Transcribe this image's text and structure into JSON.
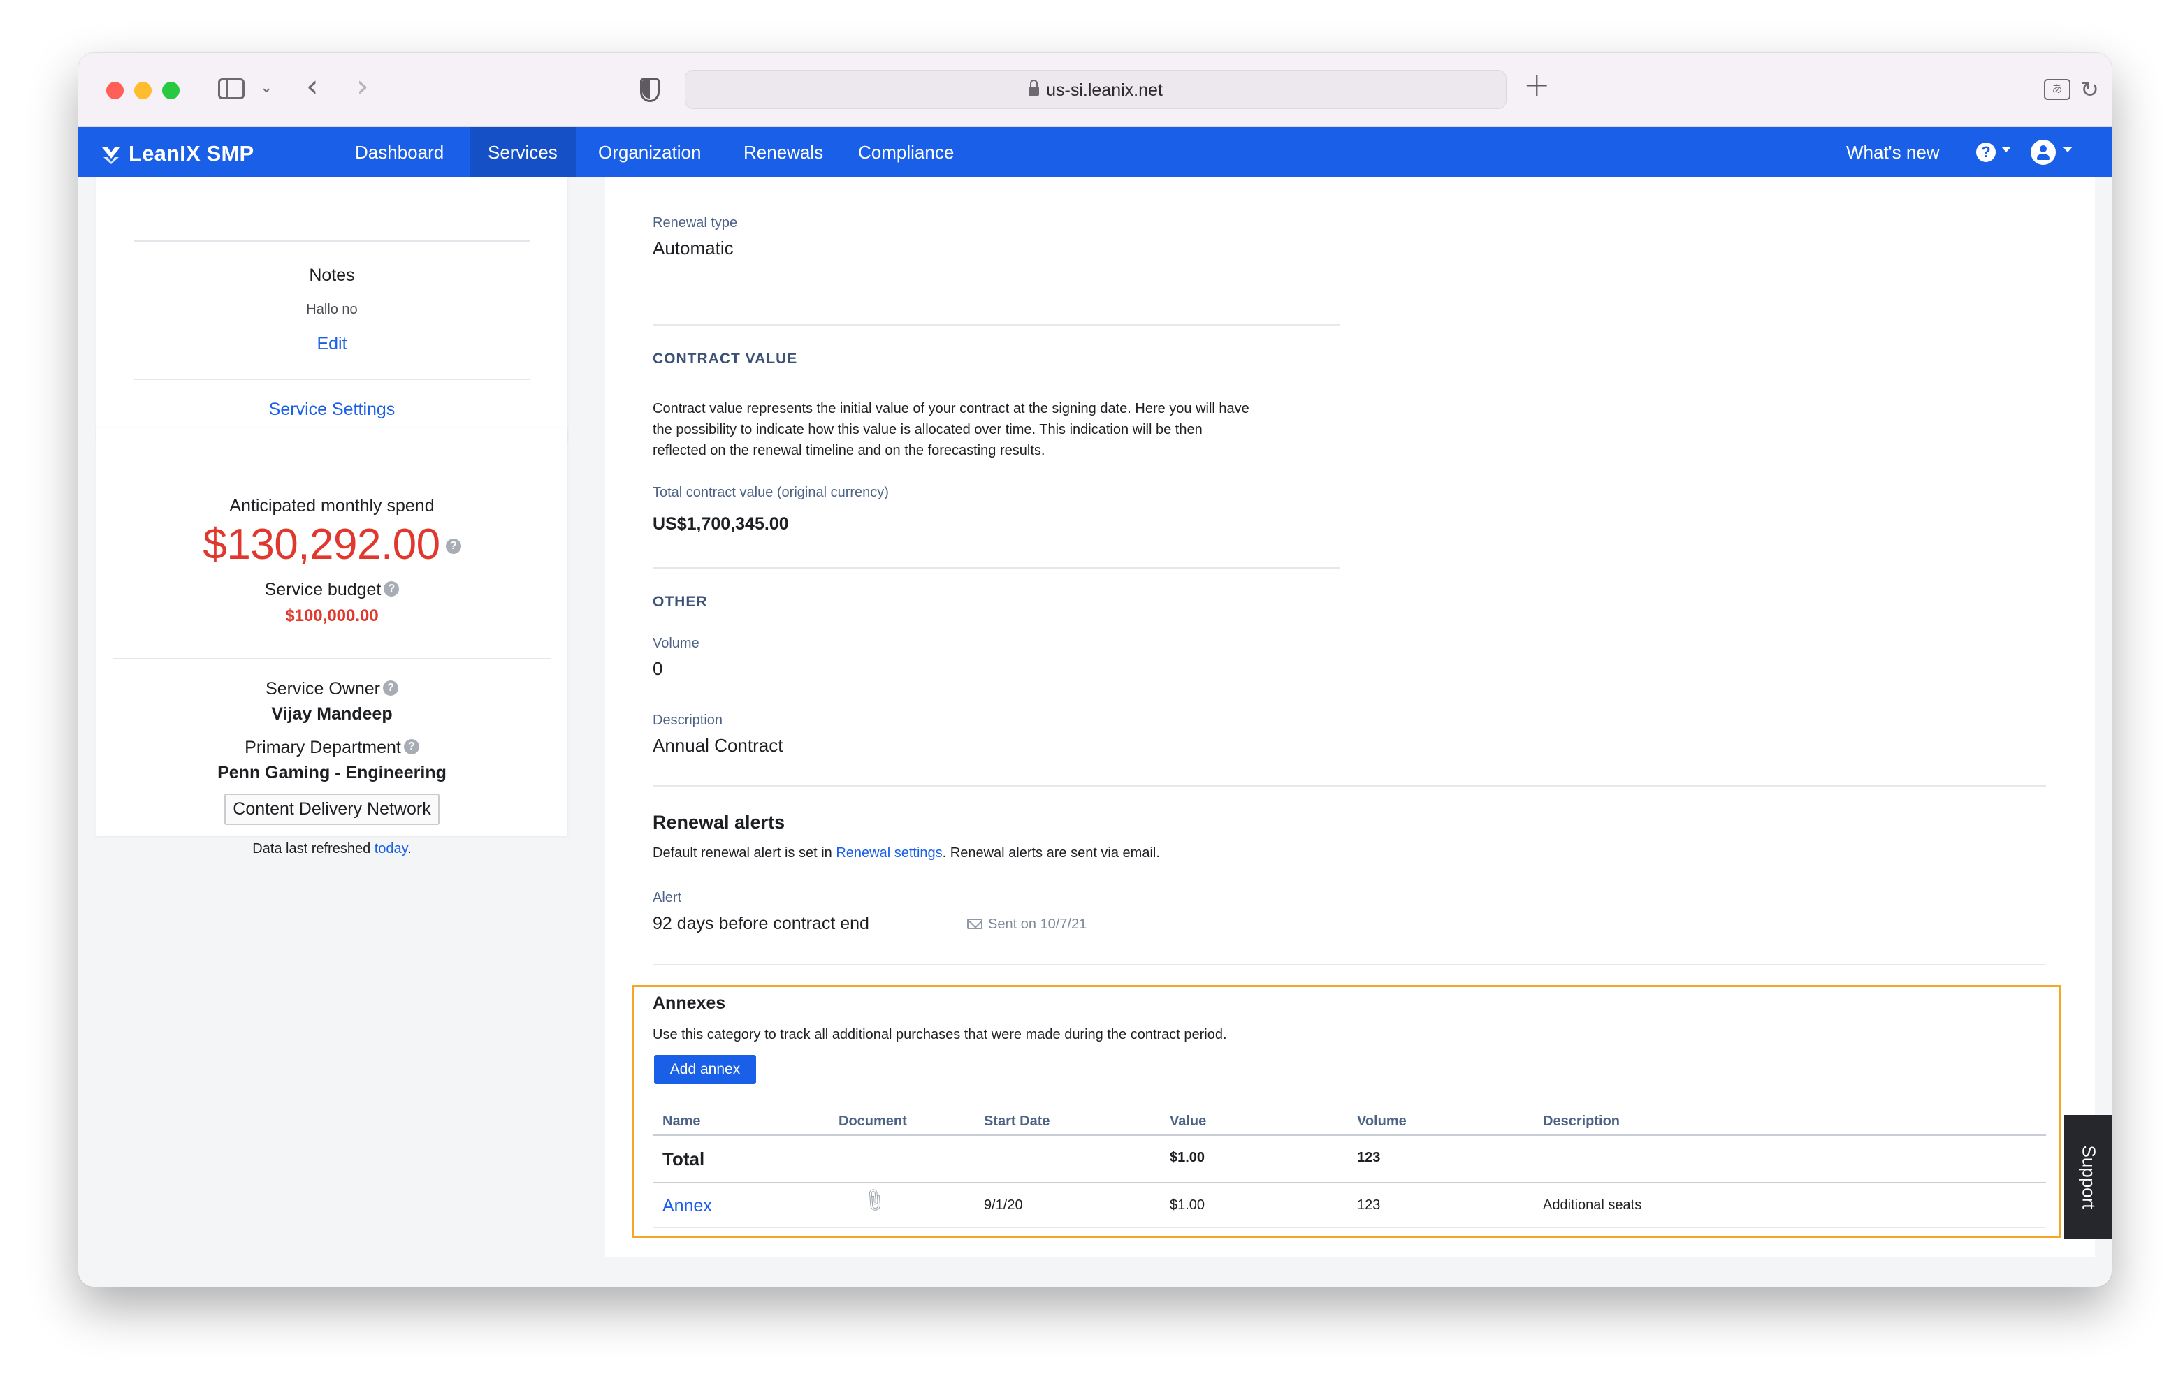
{
  "browser": {
    "url": "us-si.leanix.net"
  },
  "nav": {
    "brand": "LeanIX SMP",
    "items": [
      "Dashboard",
      "Services",
      "Organization",
      "Renewals",
      "Compliance"
    ],
    "active": "Services",
    "whats_new": "What's new",
    "help_glyph": "?"
  },
  "sidebar": {
    "notes_title": "Notes",
    "notes_text": "Hallo no",
    "edit_link": "Edit",
    "service_settings_link": "Service Settings",
    "spend_label": "Anticipated monthly spend",
    "spend_value": "$130,292.00",
    "budget_label": "Service budget",
    "budget_value": "$100,000.00",
    "owner_label": "Service Owner",
    "owner_value": "Vijay Mandeep",
    "department_label": "Primary Department",
    "department_value": "Penn Gaming - Engineering",
    "category_tag": "Content Delivery Network",
    "refreshed_prefix": "Data last refreshed ",
    "refreshed_link": "today",
    "refreshed_suffix": "."
  },
  "contract": {
    "renewal_type_label": "Renewal type",
    "renewal_type_value": "Automatic",
    "contract_value_heading": "CONTRACT VALUE",
    "contract_value_desc_1": "Contract value represents the initial value of your contract at the signing date. Here you will have",
    "contract_value_desc_2": "the possibility to indicate how this value is allocated over time. This indication will be then",
    "contract_value_desc_3": "reflected on the renewal timeline and on the forecasting results.",
    "total_label": "Total contract value (original currency)",
    "total_value": "US$1,700,345.00",
    "other_heading": "OTHER",
    "volume_label": "Volume",
    "volume_value": "0",
    "description_label": "Description",
    "description_value": "Annual Contract"
  },
  "renewal_alerts": {
    "title": "Renewal alerts",
    "desc_prefix": "Default renewal alert is set in ",
    "desc_link": "Renewal settings",
    "desc_suffix": ". Renewal alerts are sent via email.",
    "alert_label": "Alert",
    "alert_value": "92 days before contract end",
    "sent_text": "Sent on 10/7/21"
  },
  "annexes": {
    "title": "Annexes",
    "description": "Use this category to track all additional purchases that were made during the contract period.",
    "add_button": "Add annex",
    "columns": [
      "Name",
      "Document",
      "Start Date",
      "Value",
      "Volume",
      "Description"
    ],
    "total_row": {
      "name": "Total",
      "value": "$1.00",
      "volume": "123"
    },
    "rows": [
      {
        "name": "Annex",
        "start_date": "9/1/20",
        "value": "$1.00",
        "volume": "123",
        "description": "Additional seats"
      }
    ]
  },
  "support_tab": "Support",
  "colors": {
    "nav_blue": "#1a5fe8",
    "spend_red": "#e0382e",
    "highlight_orange": "#f5a623"
  }
}
